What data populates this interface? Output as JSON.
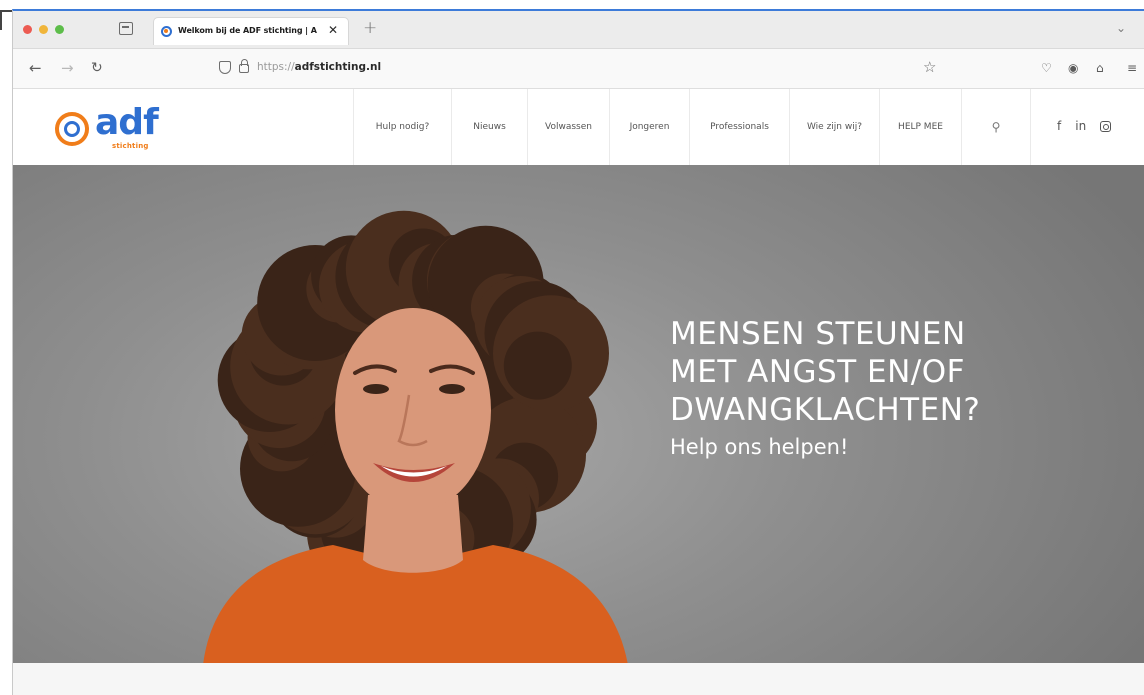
{
  "browser": {
    "tab_title": "Welkom bij de ADF stichting | A",
    "tab_close": "✕",
    "new_tab": "+",
    "tab_list": "⌄",
    "url_prefix": "https://",
    "url_domain": "adfstichting.nl",
    "back": "←",
    "forward": "→",
    "reload": "↻",
    "bookmark": "☆",
    "toolbar_icons": {
      "pocket": "♡",
      "account": "◉",
      "home": "⌂",
      "more": "≡"
    }
  },
  "site": {
    "logo": {
      "text": "adf",
      "subtext": "stichting",
      "brand_blue": "#2f6fd0",
      "brand_orange": "#f07d1a"
    },
    "menu": [
      {
        "label": "Hulp nodig?"
      },
      {
        "label": "Nieuws"
      },
      {
        "label": "Volwassen"
      },
      {
        "label": "Jongeren"
      },
      {
        "label": "Professionals"
      },
      {
        "label": "Wie zijn wij?"
      },
      {
        "label": "HELP MEE"
      }
    ],
    "search_icon": "⚲",
    "socials": {
      "facebook": "f",
      "linkedin": "in"
    }
  },
  "hero": {
    "title_lines": [
      "MENSEN STEUNEN",
      "MET ANGST EN/OF",
      "DWANGKLACHTEN?"
    ],
    "subtitle": "Help ons helpen!",
    "photo_colors": {
      "hair": "#3a2418",
      "skin": "#d9987a",
      "shirt": "#d9601f"
    }
  }
}
